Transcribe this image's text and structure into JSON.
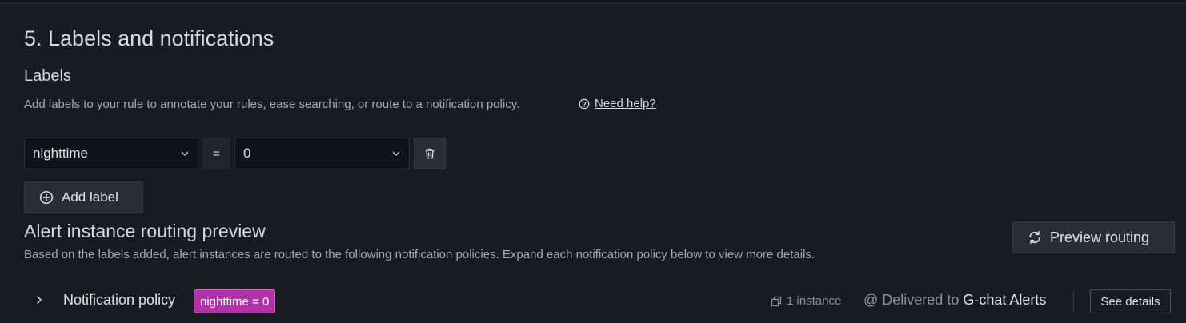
{
  "section": {
    "title": "5. Labels and notifications"
  },
  "labels": {
    "heading": "Labels",
    "description": "Add labels to your rule to annotate your rules, ease searching, or route to a notification policy.",
    "help_link": "Need help?",
    "rows": [
      {
        "key": "nighttime",
        "operator": "=",
        "value": "0"
      }
    ],
    "add_button": "Add label"
  },
  "routing_preview": {
    "heading": "Alert instance routing preview",
    "description": "Based on the labels added, alert instances are routed to the following notification policies. Expand each notification policy below to view more details.",
    "preview_button": "Preview routing",
    "policies": [
      {
        "title": "Notification policy",
        "matcher": "nighttime = 0",
        "instances": "1 instance",
        "delivered_prefix": "Delivered to",
        "contact_point": "G-chat Alerts",
        "details_button": "See details"
      }
    ]
  },
  "colors": {
    "background": "#181b1f",
    "matcher_badge": "#b033a8",
    "text_primary": "#e0e1e8",
    "text_secondary": "#a8aab3"
  },
  "icons": {
    "help": "question-circle-icon",
    "chevron": "chevron-down-icon",
    "delete": "trash-icon",
    "add": "plus-circle-icon",
    "preview": "sync-icon",
    "expand": "chevron-right-icon",
    "instances": "copy-icon",
    "delivered": "at-icon"
  }
}
